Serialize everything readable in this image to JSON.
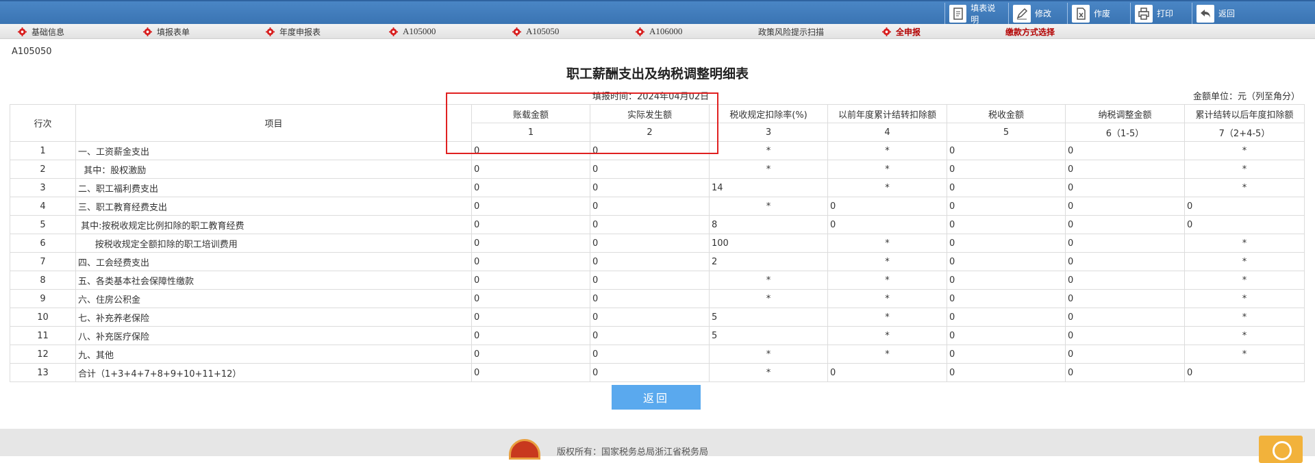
{
  "toolbar": {
    "items": [
      {
        "label": "填表说明",
        "icon": "form-doc-icon"
      },
      {
        "label": "修改",
        "icon": "pencil-icon"
      },
      {
        "label": "作废",
        "icon": "void-doc-icon"
      },
      {
        "label": "打印",
        "icon": "printer-icon"
      },
      {
        "label": "返回",
        "icon": "back-arrow-icon"
      }
    ]
  },
  "nav": {
    "items": [
      {
        "label": "基础信息",
        "gear": true
      },
      {
        "label": "填报表单",
        "gear": true
      },
      {
        "label": "年度申报表",
        "gear": true
      },
      {
        "label": "A105000",
        "gear": true
      },
      {
        "label": "A105050",
        "gear": true
      },
      {
        "label": "A106000",
        "gear": true
      },
      {
        "label": "政策风险提示扫描",
        "gear": false
      },
      {
        "label": "全申报",
        "gear": true
      },
      {
        "label": "缴款方式选择",
        "gear": false
      }
    ],
    "accent_color": "#b30000"
  },
  "page": {
    "form_code": "A105050",
    "title": "职工薪酬支出及纳税调整明细表",
    "fill_time": "填报时间：2024年04月02日",
    "unit": "金额单位：元（列至角分）"
  },
  "table": {
    "head": {
      "row_no": "行次",
      "item": "项目",
      "cols": [
        "账载金额",
        "实际发生额",
        "税收规定扣除率(%)",
        "以前年度累计结转扣除额",
        "税收金额",
        "纳税调整金额",
        "累计结转以后年度扣除额"
      ],
      "col_nums": [
        "1",
        "2",
        "3",
        "4",
        "5",
        "6（1-5）",
        "7（2+4-5）"
      ]
    },
    "rows": [
      {
        "no": "1",
        "item": "一、工资薪金支出",
        "vals": [
          "0",
          "0",
          "*",
          "*",
          "0",
          "0",
          "*"
        ]
      },
      {
        "no": "2",
        "item": "  其中：股权激励",
        "vals": [
          "0",
          "0",
          "*",
          "*",
          "0",
          "0",
          "*"
        ]
      },
      {
        "no": "3",
        "item": "二、职工福利费支出",
        "vals": [
          "0",
          "0",
          "14",
          "*",
          "0",
          "0",
          "*"
        ]
      },
      {
        "no": "4",
        "item": "三、职工教育经费支出",
        "vals": [
          "0",
          "0",
          "*",
          "0",
          "0",
          "0",
          "0"
        ]
      },
      {
        "no": "5",
        "item": " 其中:按税收规定比例扣除的职工教育经费",
        "vals": [
          "0",
          "0",
          "8",
          "0",
          "0",
          "0",
          "0"
        ]
      },
      {
        "no": "6",
        "item": "      按税收规定全额扣除的职工培训费用",
        "vals": [
          "0",
          "0",
          "100",
          "*",
          "0",
          "0",
          "*"
        ]
      },
      {
        "no": "7",
        "item": "四、工会经费支出",
        "vals": [
          "0",
          "0",
          "2",
          "*",
          "0",
          "0",
          "*"
        ]
      },
      {
        "no": "8",
        "item": "五、各类基本社会保障性缴款",
        "vals": [
          "0",
          "0",
          "*",
          "*",
          "0",
          "0",
          "*"
        ]
      },
      {
        "no": "9",
        "item": "六、住房公积金",
        "vals": [
          "0",
          "0",
          "*",
          "*",
          "0",
          "0",
          "*"
        ]
      },
      {
        "no": "10",
        "item": "七、补充养老保险",
        "vals": [
          "0",
          "0",
          "5",
          "*",
          "0",
          "0",
          "*"
        ]
      },
      {
        "no": "11",
        "item": "八、补充医疗保险",
        "vals": [
          "0",
          "0",
          "5",
          "*",
          "0",
          "0",
          "*"
        ]
      },
      {
        "no": "12",
        "item": "九、其他",
        "vals": [
          "0",
          "0",
          "*",
          "*",
          "0",
          "0",
          "*"
        ]
      },
      {
        "no": "13",
        "item": "合计（1+3+4+7+8+9+10+11+12）",
        "vals": [
          "0",
          "0",
          "*",
          "0",
          "0",
          "0",
          "0"
        ]
      }
    ]
  },
  "actions": {
    "back_label": "返回"
  },
  "footer": {
    "copyright": "版权所有：国家税务总局浙江省税务局"
  }
}
